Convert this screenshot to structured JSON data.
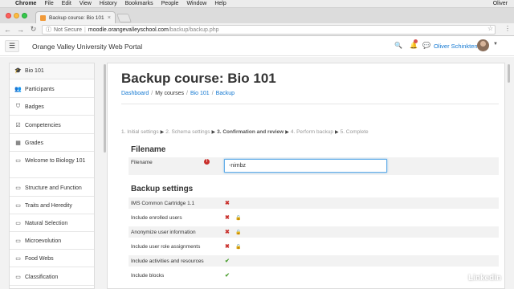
{
  "menubar": {
    "apple": "",
    "items": [
      "Chrome",
      "File",
      "Edit",
      "View",
      "History",
      "Bookmarks",
      "People",
      "Window",
      "Help"
    ],
    "user": "Oliver"
  },
  "browser": {
    "tab_title": "Backup course: Bio 101",
    "tab_close": "×",
    "url_notsecure": "Not Secure",
    "url_sep": "|",
    "url_host": "moodle.orangevalleyschool.com",
    "url_path": "/backup/backup.php"
  },
  "header": {
    "site_name": "Orange Valley University Web Portal",
    "user_name": "Oliver Schinkten"
  },
  "drawer": {
    "items": [
      {
        "icon": "graduation-cap-icon",
        "glyph": "🎓",
        "label": "Bio 101"
      },
      {
        "icon": "users-icon",
        "glyph": "👥",
        "label": "Participants"
      },
      {
        "icon": "shield-icon",
        "glyph": "⛉",
        "label": "Badges"
      },
      {
        "icon": "checkbox-icon",
        "glyph": "☑",
        "label": "Competencies"
      },
      {
        "icon": "table-icon",
        "glyph": "▦",
        "label": "Grades"
      },
      {
        "icon": "folder-icon",
        "glyph": "▭",
        "label": "Welcome to Biology 101"
      },
      {
        "icon": "folder-icon",
        "glyph": "▭",
        "label": "Structure and Function"
      },
      {
        "icon": "folder-icon",
        "glyph": "▭",
        "label": "Traits and Heredity"
      },
      {
        "icon": "folder-icon",
        "glyph": "▭",
        "label": "Natural Selection"
      },
      {
        "icon": "folder-icon",
        "glyph": "▭",
        "label": "Microevolution"
      },
      {
        "icon": "folder-icon",
        "glyph": "▭",
        "label": "Food Webs"
      },
      {
        "icon": "folder-icon",
        "glyph": "▭",
        "label": "Classification"
      }
    ]
  },
  "main": {
    "title": "Backup course: Bio 101",
    "breadcrumb": [
      "Dashboard",
      "My courses",
      "Bio 101",
      "Backup"
    ],
    "steps": [
      {
        "label": "1. Initial settings",
        "current": false
      },
      {
        "label": "2. Schema settings",
        "current": false
      },
      {
        "label": "3. Confirmation and review",
        "current": true
      },
      {
        "label": "4. Perform backup",
        "current": false
      },
      {
        "label": "5. Complete",
        "current": false
      }
    ],
    "filename_heading": "Filename",
    "filename_label": "Filename",
    "filename_value": "-nimbz",
    "backup_heading": "Backup settings",
    "settings": [
      {
        "label": "IMS Common Cartridge 1.1",
        "mark": "✖",
        "state": "x",
        "locked": false
      },
      {
        "label": "Include enrolled users",
        "mark": "✖",
        "state": "x",
        "locked": true
      },
      {
        "label": "Anonymize user information",
        "mark": "✖",
        "state": "x",
        "locked": true
      },
      {
        "label": "Include user role assignments",
        "mark": "✖",
        "state": "x",
        "locked": true
      },
      {
        "label": "Include activities and resources",
        "mark": "✔",
        "state": "ok",
        "locked": false
      },
      {
        "label": "Include blocks",
        "mark": "✔",
        "state": "ok",
        "locked": false
      }
    ]
  },
  "watermark": {
    "text": "Linked",
    "in": "in"
  },
  "colors": {
    "link": "#1177d1",
    "error": "#c9302c",
    "success": "#4a9e2f"
  }
}
